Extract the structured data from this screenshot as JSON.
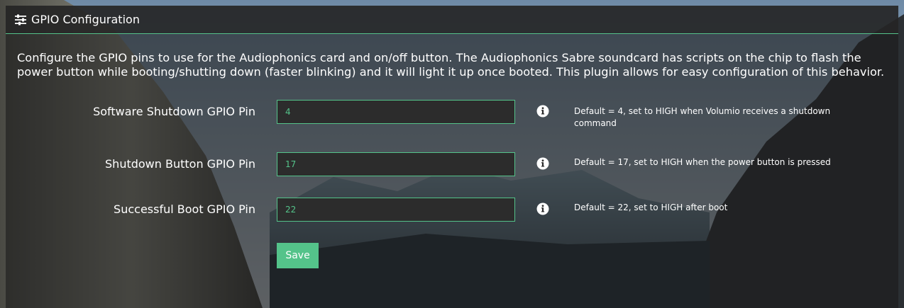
{
  "panel": {
    "title": "GPIO Configuration",
    "icon": "sliders-icon",
    "description": "Configure the GPIO pins to use for the Audiophonics card and on/off button. The Audiophonics Sabre soundcard has scripts on the chip to flash the power button while booting/shutting down (faster blinking) and it will light it up once booted. This plugin allows for easy configuration of this behavior."
  },
  "fields": [
    {
      "label": "Software Shutdown GPIO Pin",
      "value": "4",
      "help": "Default = 4, set to HIGH when Volumio receives a shutdown command",
      "icon": "info-icon"
    },
    {
      "label": "Shutdown Button GPIO Pin",
      "value": "17",
      "help": "Default = 17, set to HIGH when the power button is pressed",
      "icon": "info-icon"
    },
    {
      "label": "Successful Boot GPIO Pin",
      "value": "22",
      "help": "Default = 22, set to HIGH after boot",
      "icon": "info-icon"
    }
  ],
  "actions": {
    "save_label": "Save"
  },
  "colors": {
    "accent": "#54c38a",
    "input_bg": "#2c2c2c",
    "panel_bg": "#1c1c1c"
  }
}
